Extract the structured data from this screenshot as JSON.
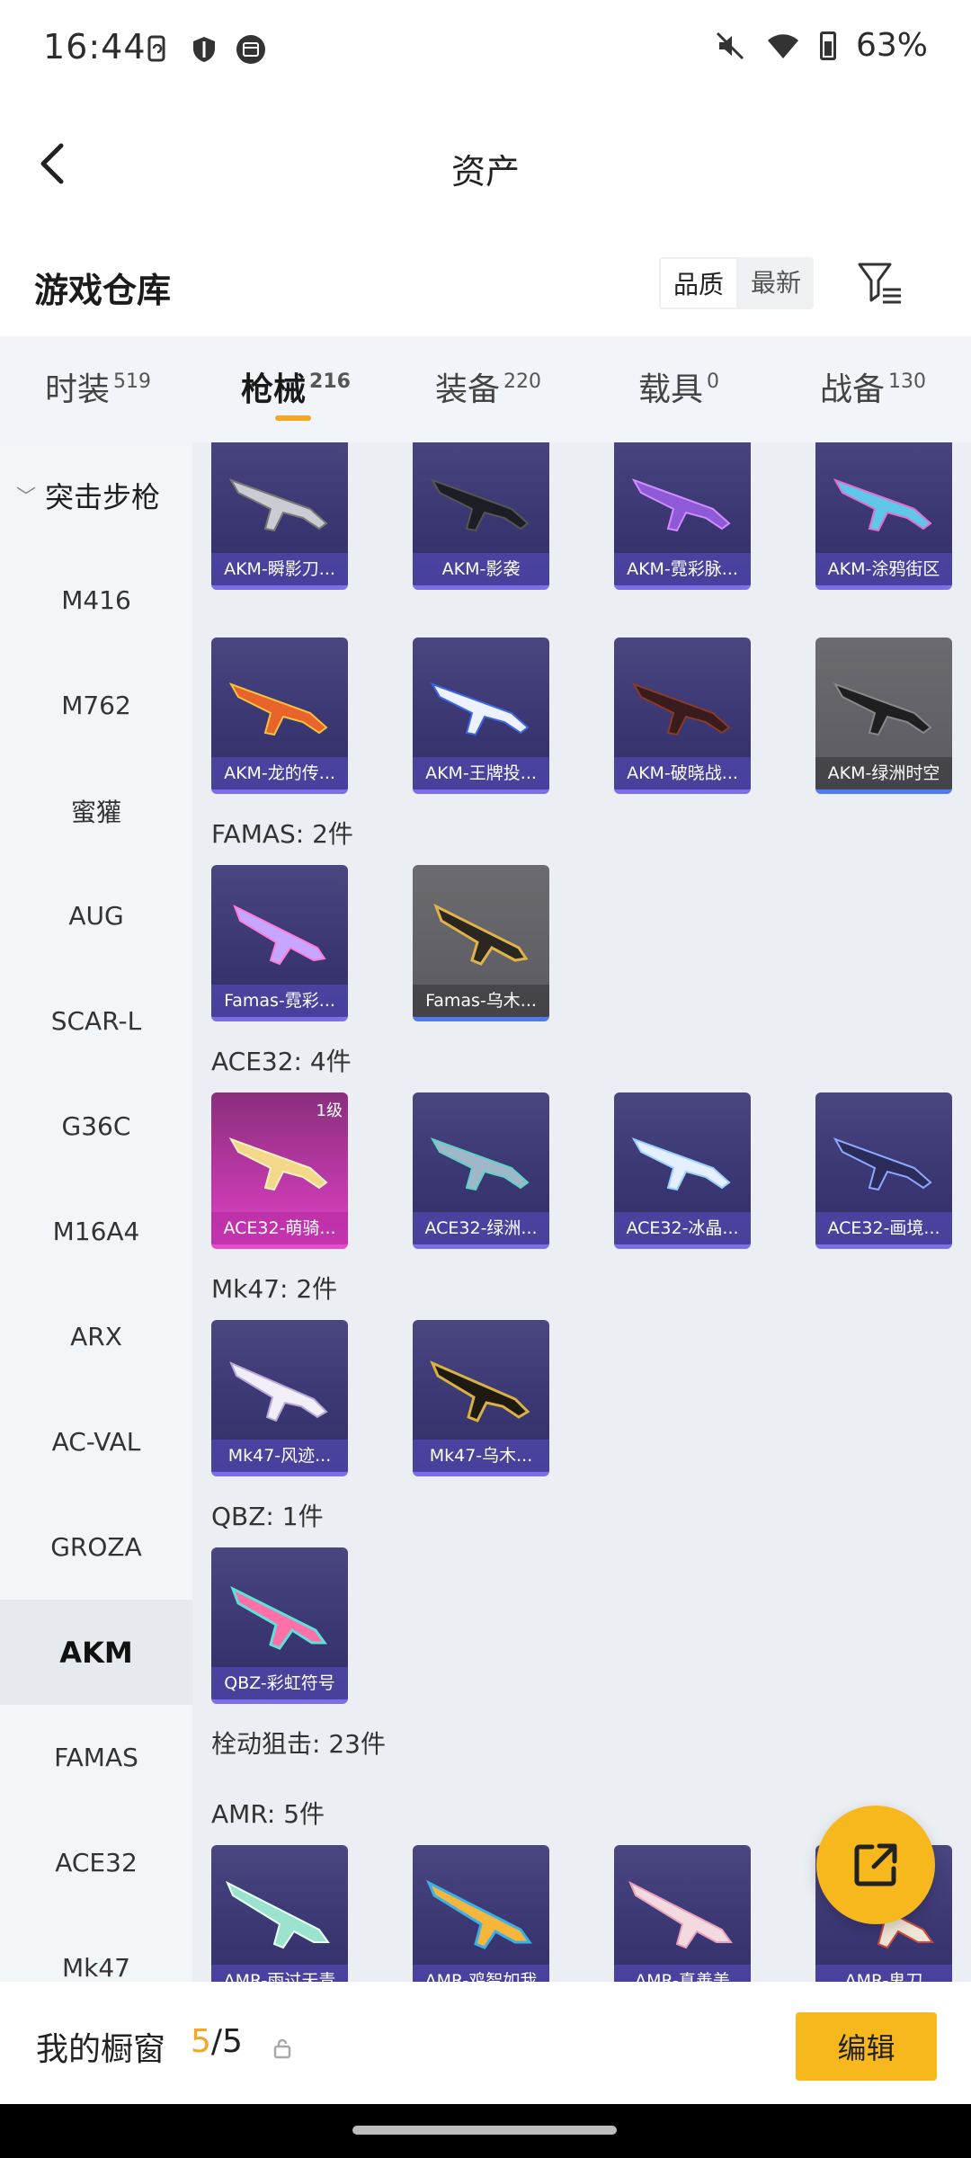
{
  "status_bar": {
    "time": "16:44",
    "battery": "63%",
    "left_icons": [
      "phone-sync-icon",
      "shield-icon",
      "calendar-icon"
    ],
    "right_icons": [
      "mute-icon",
      "wifi-icon",
      "battery-icon"
    ]
  },
  "header": {
    "title": "资产"
  },
  "section": {
    "title": "游戏仓库",
    "sort_options": [
      "品质",
      "最新"
    ],
    "sort_selected": "品质"
  },
  "tabs": [
    {
      "label": "时装",
      "count": "519"
    },
    {
      "label": "枪械",
      "count": "216"
    },
    {
      "label": "装备",
      "count": "220"
    },
    {
      "label": "载具",
      "count": "0"
    },
    {
      "label": "战备",
      "count": "130"
    }
  ],
  "sidebar": {
    "group": "突击步枪",
    "items": [
      "M416",
      "M762",
      "蜜獾",
      "AUG",
      "SCAR-L",
      "G36C",
      "M16A4",
      "ARX",
      "AC-VAL",
      "GROZA",
      "AKM",
      "FAMAS",
      "ACE32",
      "Mk47"
    ],
    "active": "AKM"
  },
  "content": {
    "akm_row1": [
      "AKM-瞬影刀...",
      "AKM-影袭",
      "AKM-霓彩脉...",
      "AKM-涂鸦街区"
    ],
    "akm_row2": [
      "AKM-龙的传...",
      "AKM-王牌投...",
      "AKM-破晓战...",
      "AKM-绿洲时空"
    ],
    "famas_label": "FAMAS: 2件",
    "famas": [
      "Famas-霓彩...",
      "Famas-乌木..."
    ],
    "ace32_label": "ACE32: 4件",
    "ace32": [
      "ACE32-萌骑...",
      "ACE32-绿洲...",
      "ACE32-冰晶...",
      "ACE32-画境..."
    ],
    "ace32_badge": "1级",
    "mk47_label": "Mk47: 2件",
    "mk47": [
      "Mk47-风迹...",
      "Mk47-乌木..."
    ],
    "qbz_label": "QBZ: 1件",
    "qbz": [
      "QBZ-彩虹符号"
    ],
    "sniper_label": "栓动狙击: 23件",
    "amr_label": "AMR: 5件",
    "amr": [
      "AMR-雨过天青",
      "AMR-鸡智如我",
      "AMR-真善美",
      "AMR-鬼刀"
    ]
  },
  "bottom_bar": {
    "label": "我的橱窗",
    "current": "5",
    "separator": "/",
    "total": "5",
    "edit_label": "编辑"
  },
  "colors": {
    "accent": "#f7b81e",
    "highlight": "#f5a623",
    "card_purple": "#3b3773",
    "card_pink": "#c63ab0",
    "card_grey": "#5a5a60"
  }
}
